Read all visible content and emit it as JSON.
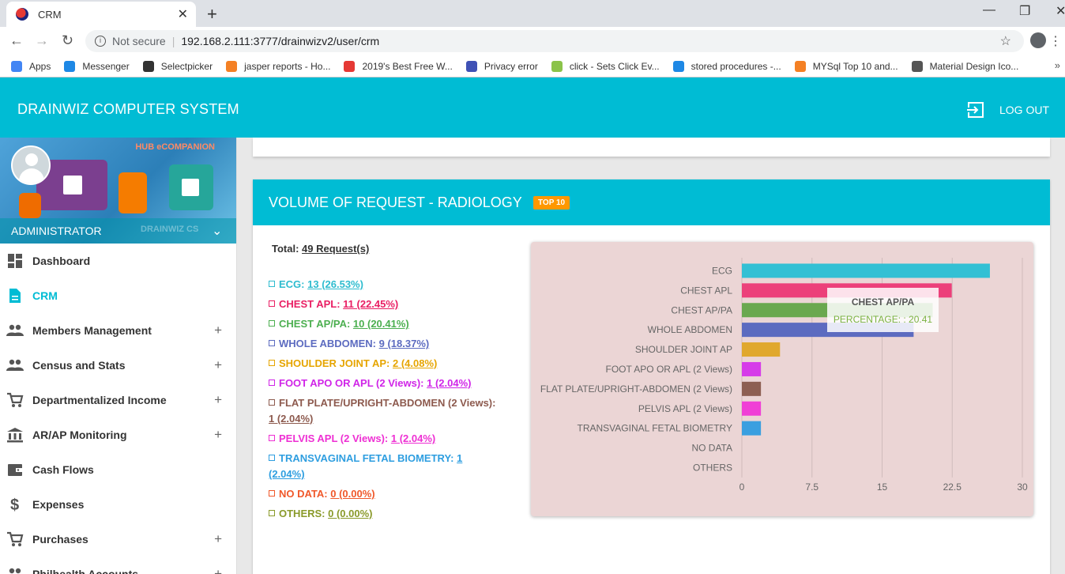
{
  "browser": {
    "tab_title": "CRM",
    "tab_close": "✕",
    "new_tab": "+",
    "not_secure": "Not secure",
    "url": "192.168.2.111:3777/drainwizv2/user/crm",
    "bookmarks": [
      {
        "label": "Apps",
        "color": "#4285f4"
      },
      {
        "label": "Messenger",
        "color": "#1e88e5"
      },
      {
        "label": "Selectpicker",
        "color": "#333333"
      },
      {
        "label": "jasper reports - Ho...",
        "color": "#f48024"
      },
      {
        "label": "2019's Best Free W...",
        "color": "#e53935"
      },
      {
        "label": "Privacy error",
        "color": "#3f51b5"
      },
      {
        "label": "click - Sets Click Ev...",
        "color": "#8bc34a"
      },
      {
        "label": "stored procedures -...",
        "color": "#1e88e5"
      },
      {
        "label": "MYSql Top 10 and...",
        "color": "#f48024"
      },
      {
        "label": "Material Design Ico...",
        "color": "#555555"
      }
    ],
    "more": "»"
  },
  "header": {
    "brand": "DRAINWIZ COMPUTER SYSTEM",
    "logout": "LOG OUT"
  },
  "sidebar": {
    "hub_label": "HUB eCOMPANION",
    "user": "ADMINISTRATOR",
    "watermark": "DRAINWIZ CS",
    "items": [
      {
        "label": "Dashboard",
        "icon": "dashboard-icon",
        "expand": false
      },
      {
        "label": "CRM",
        "icon": "document-icon",
        "expand": false,
        "active": true
      },
      {
        "label": "Members Management",
        "icon": "people-icon",
        "expand": true
      },
      {
        "label": "Census and Stats",
        "icon": "people-icon",
        "expand": true
      },
      {
        "label": "Departmentalized Income",
        "icon": "cart-icon",
        "expand": true
      },
      {
        "label": "AR/AP Monitoring",
        "icon": "bank-icon",
        "expand": true
      },
      {
        "label": "Cash Flows",
        "icon": "wallet-icon",
        "expand": false
      },
      {
        "label": "Expenses",
        "icon": "dollar-icon",
        "expand": false
      },
      {
        "label": "Purchases",
        "icon": "cart-icon",
        "expand": true
      },
      {
        "label": "Philhealth Accounts",
        "icon": "people-icon",
        "expand": true
      }
    ],
    "plus": "+"
  },
  "card": {
    "title": "VOLUME OF REQUEST - RADIOLOGY",
    "badge": "TOP 10",
    "total_label": "Total:",
    "total_value": "49 Request(s)",
    "stats": [
      {
        "label": "ECG:",
        "value": "13 (26.53%)",
        "color": "#2ebccf"
      },
      {
        "label": "CHEST APL:",
        "value": "11 (22.45%)",
        "color": "#e91e63"
      },
      {
        "label": "CHEST AP/PA:",
        "value": "10 (20.41%)",
        "color": "#4caf50"
      },
      {
        "label": "WHOLE ABDOMEN:",
        "value": "9 (18.37%)",
        "color": "#5c6bc0"
      },
      {
        "label": "SHOULDER JOINT AP:",
        "value": "2 (4.08%)",
        "color": "#e6a500"
      },
      {
        "label": "FOOT APO OR APL (2 Views):",
        "value": "1 (2.04%)",
        "color": "#d024e8"
      },
      {
        "label": "FLAT PLATE/UPRIGHT-ABDOMEN (2 Views):",
        "value": "1 (2.04%)",
        "color": "#8d5a4e"
      },
      {
        "label": "PELVIS APL (2 Views):",
        "value": "1 (2.04%)",
        "color": "#ee2fd3"
      },
      {
        "label": "TRANSVAGINAL FETAL BIOMETRY:",
        "value": "1 (2.04%)",
        "color": "#2e9ee0"
      },
      {
        "label": "NO DATA:",
        "value": "0 (0.00%)",
        "color": "#f0582a"
      },
      {
        "label": "OTHERS:",
        "value": "0 (0.00%)",
        "color": "#8a9a2a"
      }
    ],
    "tooltip": {
      "title": "CHEST AP/PA",
      "body": "PERCENTAGE: : 20.41"
    }
  },
  "chart_data": {
    "type": "bar",
    "orientation": "horizontal",
    "categories": [
      "ECG",
      "CHEST APL",
      "CHEST AP/PA",
      "WHOLE ABDOMEN",
      "SHOULDER JOINT AP",
      "FOOT APO OR APL (2 Views)",
      "FLAT PLATE/UPRIGHT-ABDOMEN (2 Views)",
      "PELVIS APL (2 Views)",
      "TRANSVAGINAL FETAL BIOMETRY",
      "NO DATA",
      "OTHERS"
    ],
    "values": [
      26.53,
      22.45,
      20.41,
      18.37,
      4.08,
      2.04,
      2.04,
      2.04,
      2.04,
      0,
      0
    ],
    "colors": [
      "#33c0d4",
      "#ec407a",
      "#6aa84f",
      "#5c6bc0",
      "#e0a82e",
      "#d63be9",
      "#8d5f52",
      "#f03fd6",
      "#3a9fe0",
      "#f0582a",
      "#8a9a2a"
    ],
    "xlim": [
      0,
      30
    ],
    "xticks": [
      "0",
      "7.5",
      "15",
      "22.5",
      "30"
    ],
    "grid": true,
    "legend": "none"
  }
}
